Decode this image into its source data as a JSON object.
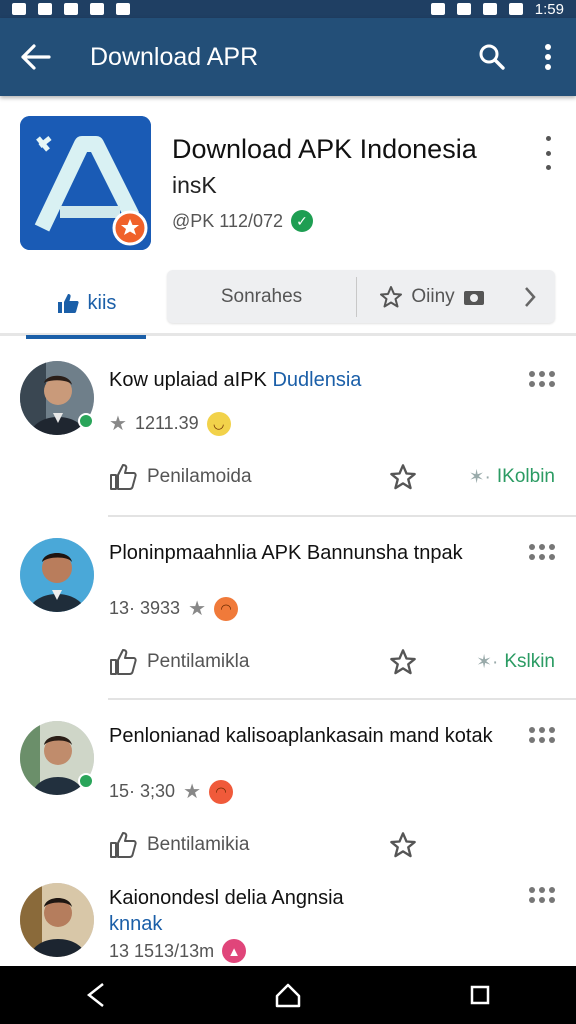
{
  "status_bar": {
    "time": "1:59"
  },
  "app_bar": {
    "title": "Download APR"
  },
  "header": {
    "title": "Download APK Indonesia",
    "subtitle": "insK",
    "meta": "@PK 112/072"
  },
  "tabs": {
    "active": "kiis",
    "second": "Sonrahes",
    "third": "Oiiny"
  },
  "items": [
    {
      "title_plain": "Kow uplaiad aIPK ",
      "title_highlight": "Dudlensia",
      "meta": "1211.39",
      "emoji_color": "#f2d24a",
      "like_label": "Penilamoida",
      "action_label": "IKolbin"
    },
    {
      "title_plain": "Ploninpmaahnlia APK Bannunsha tnpak",
      "title_highlight": "",
      "meta": "13· 3933",
      "emoji_color": "#f07a3a",
      "like_label": "Pentilamikla",
      "action_label": "Kslkin"
    },
    {
      "title_plain": "Penlonianad kalisoaplankasain mand kotak",
      "title_highlight": "",
      "meta": "15· 3;30",
      "emoji_color": "#f05a3a",
      "like_label": "Bentilamikia",
      "action_label": ""
    },
    {
      "title_plain": "Kaionondesl delia Angnsia ",
      "title_highlight": "knnak",
      "meta": "13 1513/13m",
      "emoji_color": "#e0457a",
      "like_label": "",
      "action_label": ""
    }
  ]
}
